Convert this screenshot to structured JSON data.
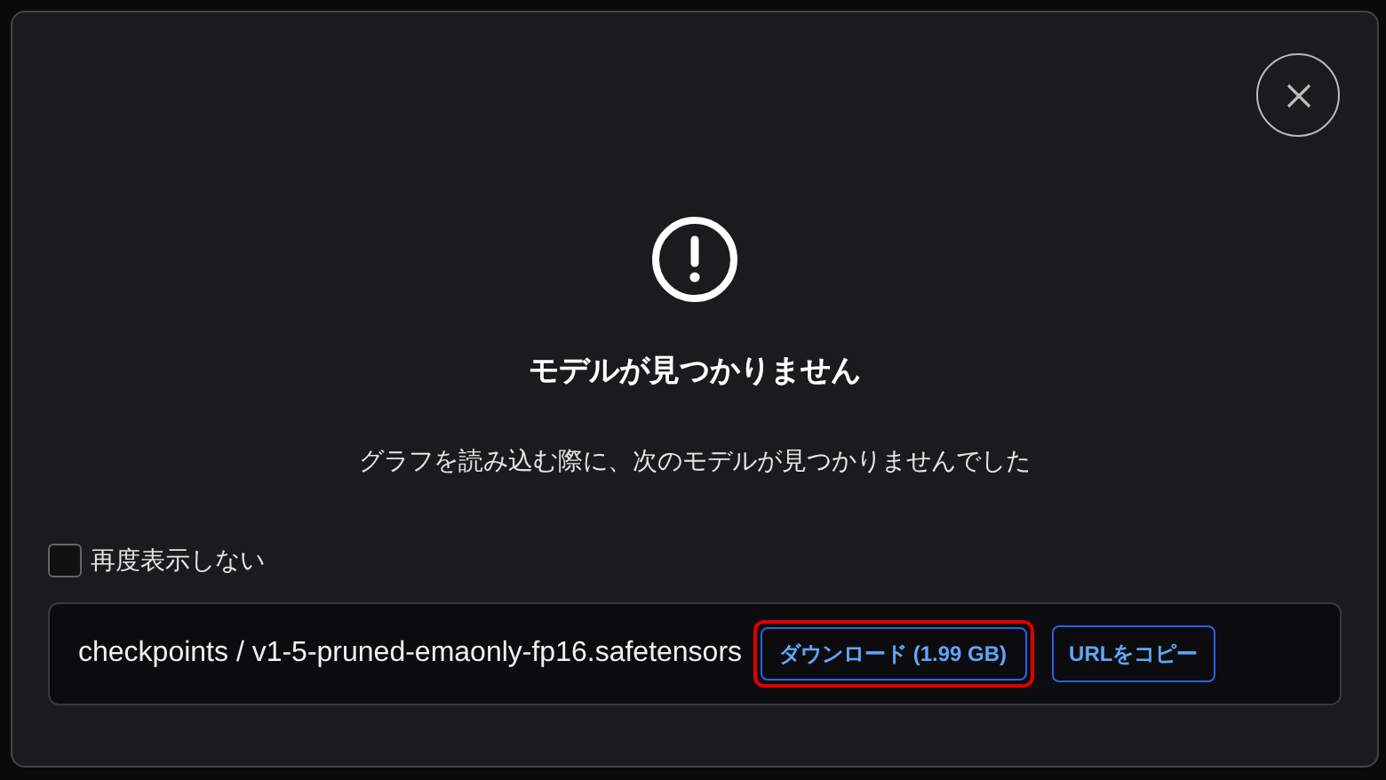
{
  "dialog": {
    "title": "モデルが見つかりません",
    "message": "グラフを読み込む際に、次のモデルが見つかりませんでした",
    "dont_show_again": {
      "label": "再度表示しない",
      "checked": false
    },
    "models": [
      {
        "path": "checkpoints / v1-5-pruned-emaonly-fp16.safetensors",
        "download": {
          "label": "ダウンロード (1.99 GB)",
          "highlighted": true
        },
        "copy": {
          "label": "URLをコピー"
        }
      }
    ]
  }
}
